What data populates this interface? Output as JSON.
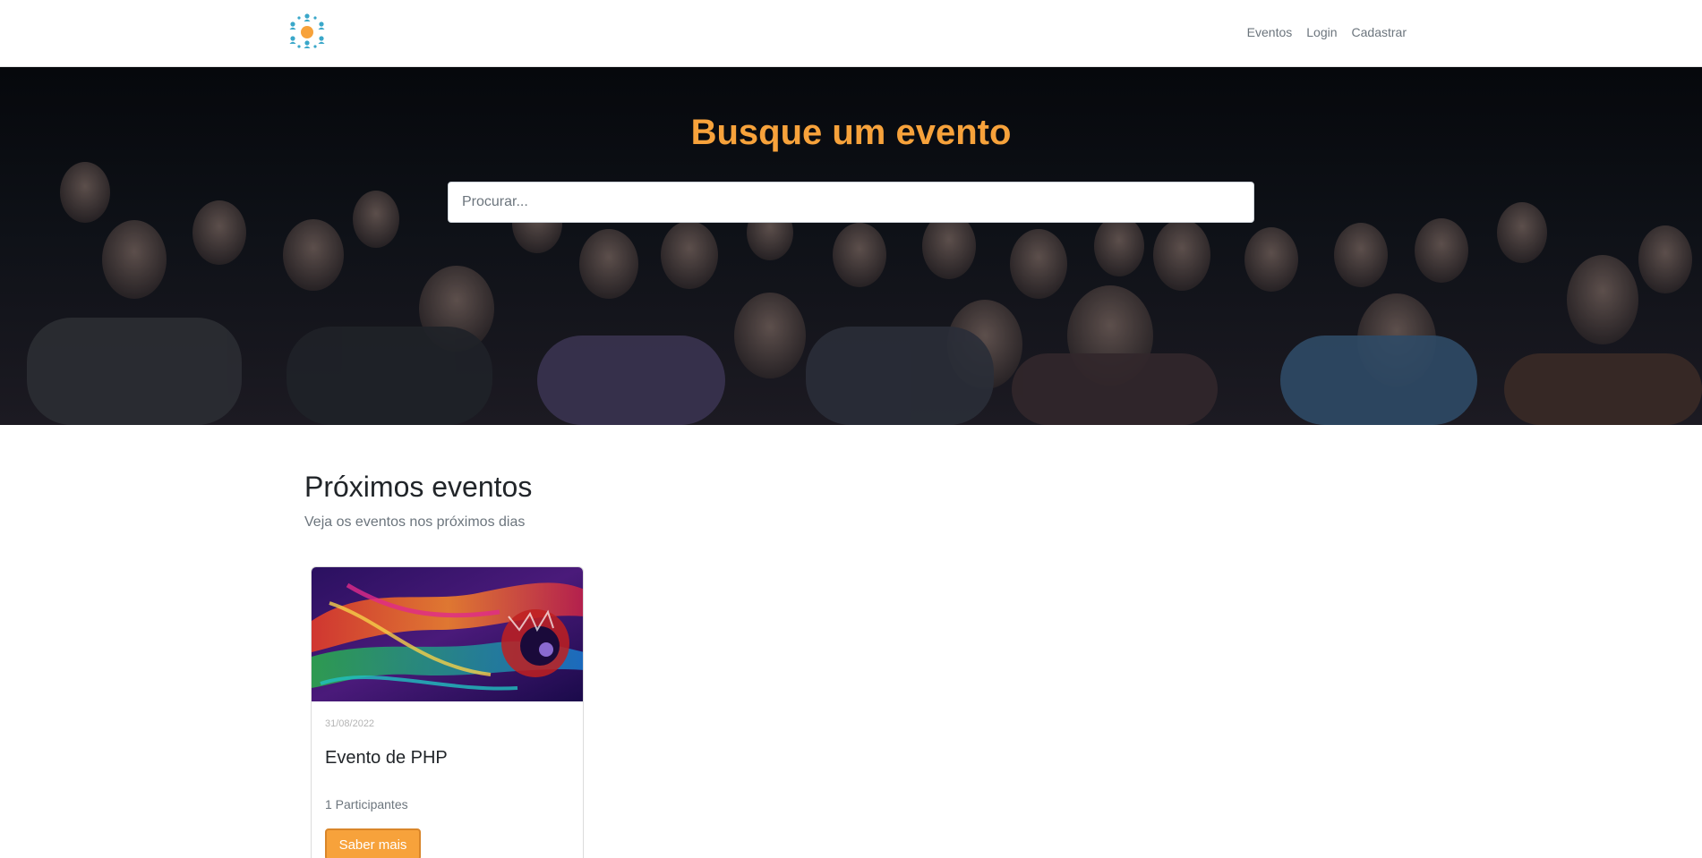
{
  "navbar": {
    "logo_icon": "people-network-logo-icon",
    "links": [
      "Eventos",
      "Login",
      "Cadastrar"
    ]
  },
  "hero": {
    "title": "Busque um evento",
    "search": {
      "placeholder": "Procurar...",
      "value": ""
    },
    "background": "audience-photo"
  },
  "events": {
    "title": "Próximos eventos",
    "subtitle": "Veja os eventos nos próximos dias",
    "cards": [
      {
        "date": "31/08/2022",
        "title": "Evento de PHP",
        "participants": "1 Participantes",
        "button_label": "Saber mais",
        "image": "colorful-dragon-art"
      }
    ]
  },
  "colors": {
    "accent": "#f7a23b",
    "logo_blue": "#3aa7c9",
    "logo_orange": "#f7a23b"
  }
}
